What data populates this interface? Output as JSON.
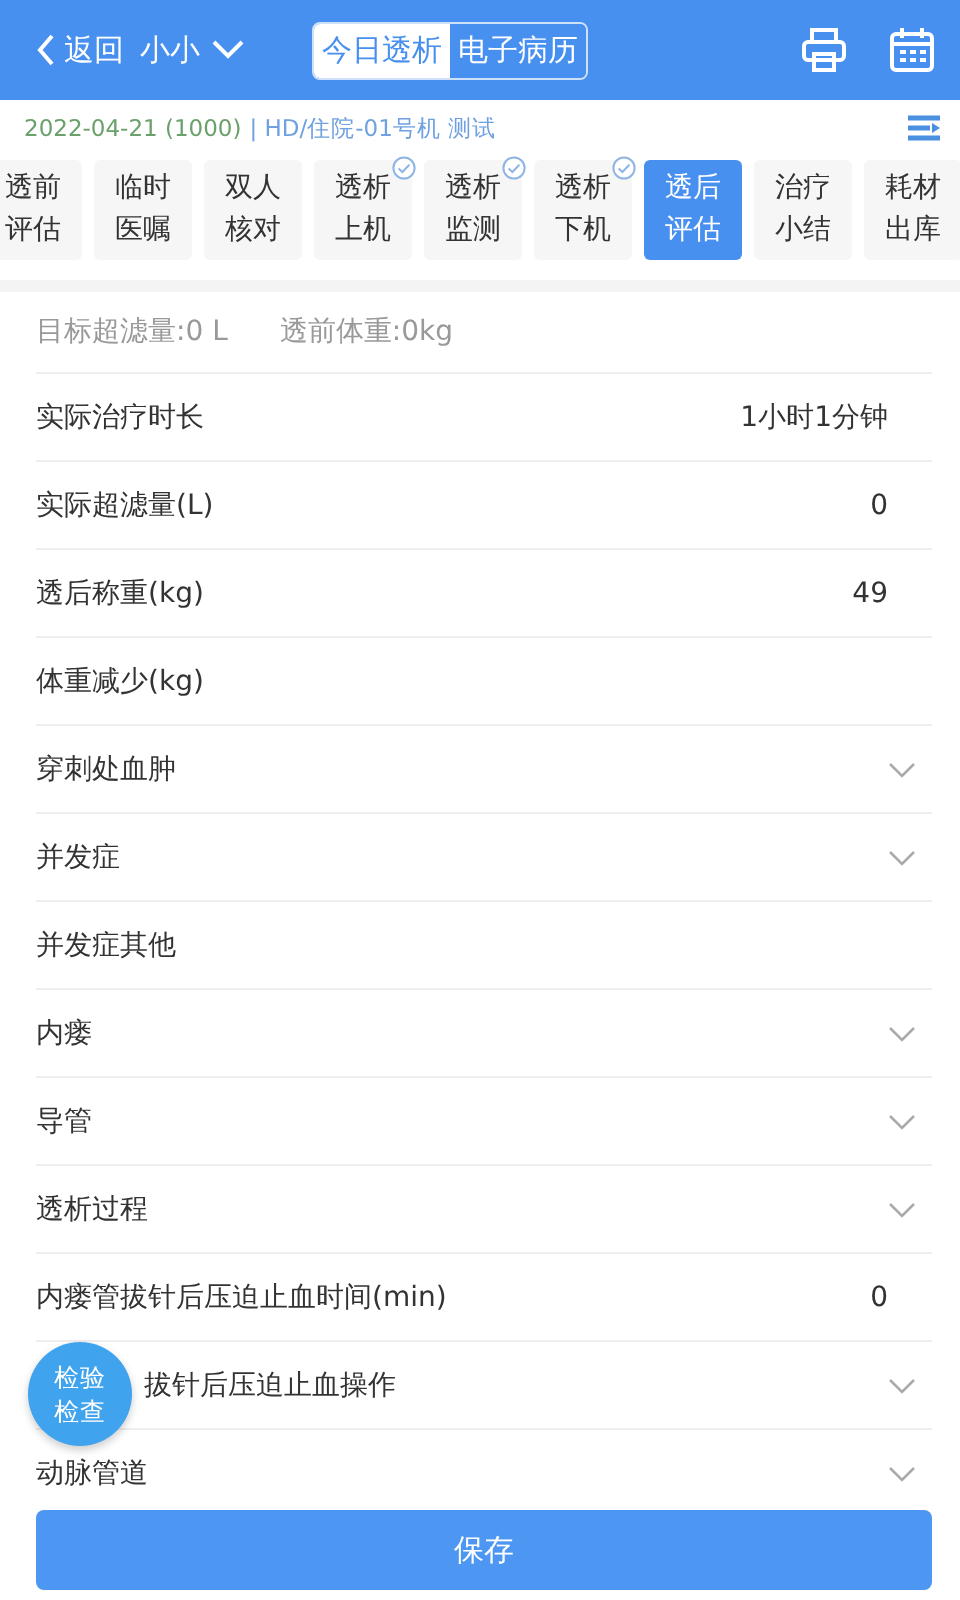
{
  "header": {
    "back": "返回",
    "patient": "小小",
    "segments": [
      {
        "label": "今日透析",
        "selected": true
      },
      {
        "label": "电子病历",
        "selected": false
      }
    ]
  },
  "info": {
    "date": "2022-04-21 (1000)",
    "machine": "| HD/住院-01号机 测试"
  },
  "tabs": [
    {
      "top": "透前",
      "bottom": "评估",
      "selected": false,
      "done": false
    },
    {
      "top": "临时",
      "bottom": "医嘱",
      "selected": false,
      "done": false
    },
    {
      "top": "双人",
      "bottom": "核对",
      "selected": false,
      "done": false
    },
    {
      "top": "透析",
      "bottom": "上机",
      "selected": false,
      "done": true
    },
    {
      "top": "透析",
      "bottom": "监测",
      "selected": false,
      "done": true
    },
    {
      "top": "透析",
      "bottom": "下机",
      "selected": false,
      "done": true
    },
    {
      "top": "透后",
      "bottom": "评估",
      "selected": true,
      "done": false
    },
    {
      "top": "治疗",
      "bottom": "小结",
      "selected": false,
      "done": false
    },
    {
      "top": "耗材",
      "bottom": "出库",
      "selected": false,
      "done": false
    }
  ],
  "summary": [
    "目标超滤量:0 L",
    "透前体重:0kg"
  ],
  "rows": [
    {
      "kind": "value",
      "label": "实际治疗时长",
      "value": "1小时1分钟"
    },
    {
      "kind": "value",
      "label": "实际超滤量(L)",
      "value": "0"
    },
    {
      "kind": "value",
      "label": "透后称重(kg)",
      "value": "49"
    },
    {
      "kind": "value",
      "label": "体重减少(kg)"
    },
    {
      "kind": "select",
      "label": "穿刺处血肿"
    },
    {
      "kind": "select",
      "label": "并发症"
    },
    {
      "kind": "value",
      "label": "并发症其他"
    },
    {
      "kind": "select",
      "label": "内瘘"
    },
    {
      "kind": "select",
      "label": "导管"
    },
    {
      "kind": "select",
      "label": "透析过程"
    },
    {
      "kind": "value",
      "label": "内瘘管拔针后压迫止血时间(min)",
      "value": "0"
    },
    {
      "kind": "select",
      "label": "拔针后压迫止血操作",
      "covered": true
    },
    {
      "kind": "select",
      "label": "动脉管道"
    }
  ],
  "float_button": [
    "检验",
    "检查"
  ],
  "save": "保存"
}
